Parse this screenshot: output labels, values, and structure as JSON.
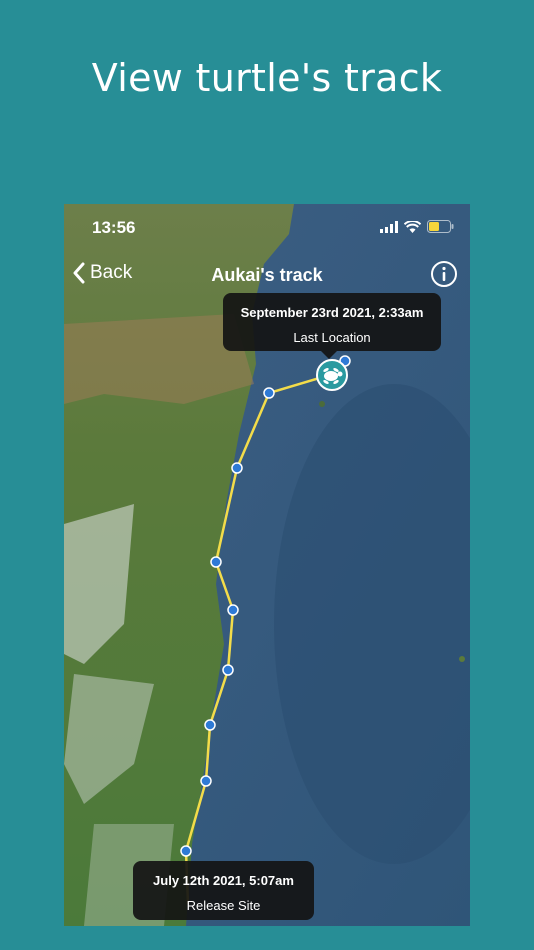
{
  "headline": "View turtle's track",
  "status_bar": {
    "time": "13:56"
  },
  "nav": {
    "back_label": "Back",
    "title": "Aukai's track",
    "info_icon": "info-icon"
  },
  "last_location": {
    "date": "September 23rd 2021, 2:33am",
    "caption": "Last Location"
  },
  "release_site": {
    "date": "July 12th 2021, 5:07am",
    "caption": "Release Site"
  },
  "colors": {
    "background": "#278e96",
    "track": "#f3dc4a",
    "waypoint": "#2e7ad6",
    "turtle_marker": "#2a9aa0",
    "ocean": "#3a5e83"
  }
}
